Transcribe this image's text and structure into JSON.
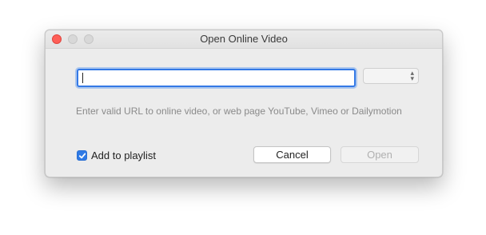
{
  "window": {
    "title": "Open Online Video"
  },
  "form": {
    "url_value": "",
    "hint": "Enter valid URL to online video, or web page YouTube, Vimeo or Dailymotion",
    "select_value": "",
    "add_to_playlist_label": "Add to playlist",
    "add_to_playlist_checked": true,
    "cancel_label": "Cancel",
    "open_label": "Open"
  },
  "colors": {
    "accent": "#3479e6",
    "close_button": "#fe5f57"
  }
}
